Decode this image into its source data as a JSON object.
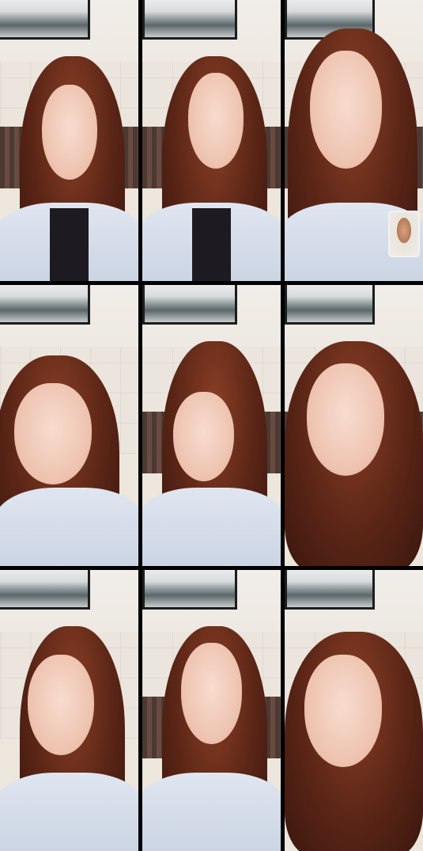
{
  "layout": {
    "columns": 3,
    "rows": 3
  },
  "frames": [
    {
      "id": 1,
      "subject": "woman-with-long-auburn-hair"
    },
    {
      "id": 2,
      "subject": "woman-with-long-auburn-hair"
    },
    {
      "id": 3,
      "subject": "woman-with-long-auburn-hair",
      "has_pip_video": true
    },
    {
      "id": 4,
      "subject": "woman-with-long-auburn-hair"
    },
    {
      "id": 5,
      "subject": "woman-with-long-auburn-hair"
    },
    {
      "id": 6,
      "subject": "woman-with-long-auburn-hair"
    },
    {
      "id": 7,
      "subject": "woman-with-long-auburn-hair"
    },
    {
      "id": 8,
      "subject": "woman-with-long-auburn-hair"
    },
    {
      "id": 9,
      "subject": "woman-with-long-auburn-hair"
    }
  ],
  "colors": {
    "background": "#000000",
    "hair": "#6b2d1a",
    "shirt": "#d6deeb"
  }
}
